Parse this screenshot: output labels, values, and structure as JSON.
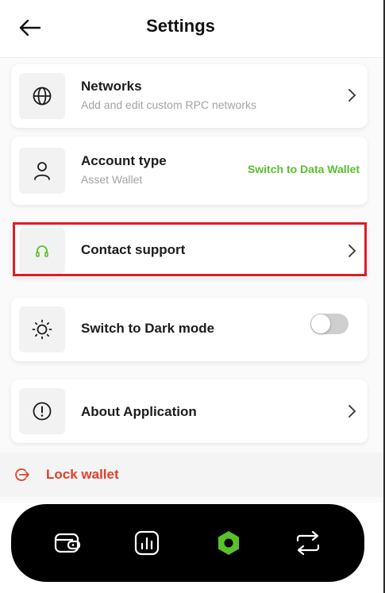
{
  "header": {
    "title": "Settings"
  },
  "items": [
    {
      "title": "Networks",
      "subtitle": "Add and edit custom RPC networks",
      "icon": "globe-icon"
    },
    {
      "title": "Account type",
      "subtitle": "Asset Wallet",
      "icon": "user-icon",
      "action": "Switch to Data Wallet"
    },
    {
      "title": "Contact support",
      "icon": "headphones-icon"
    },
    {
      "title": "Switch to Dark mode",
      "icon": "sun-icon",
      "toggle_on": false
    },
    {
      "title": "About Application",
      "icon": "info-icon"
    }
  ],
  "lock": {
    "label": "Lock wallet"
  },
  "nav": [
    "wallet-icon",
    "chart-icon",
    "settings-hex-icon",
    "swap-icon"
  ],
  "colors": {
    "accent_green": "#59c02c",
    "danger_red": "#e0402a",
    "highlight_red": "#e01b24"
  }
}
